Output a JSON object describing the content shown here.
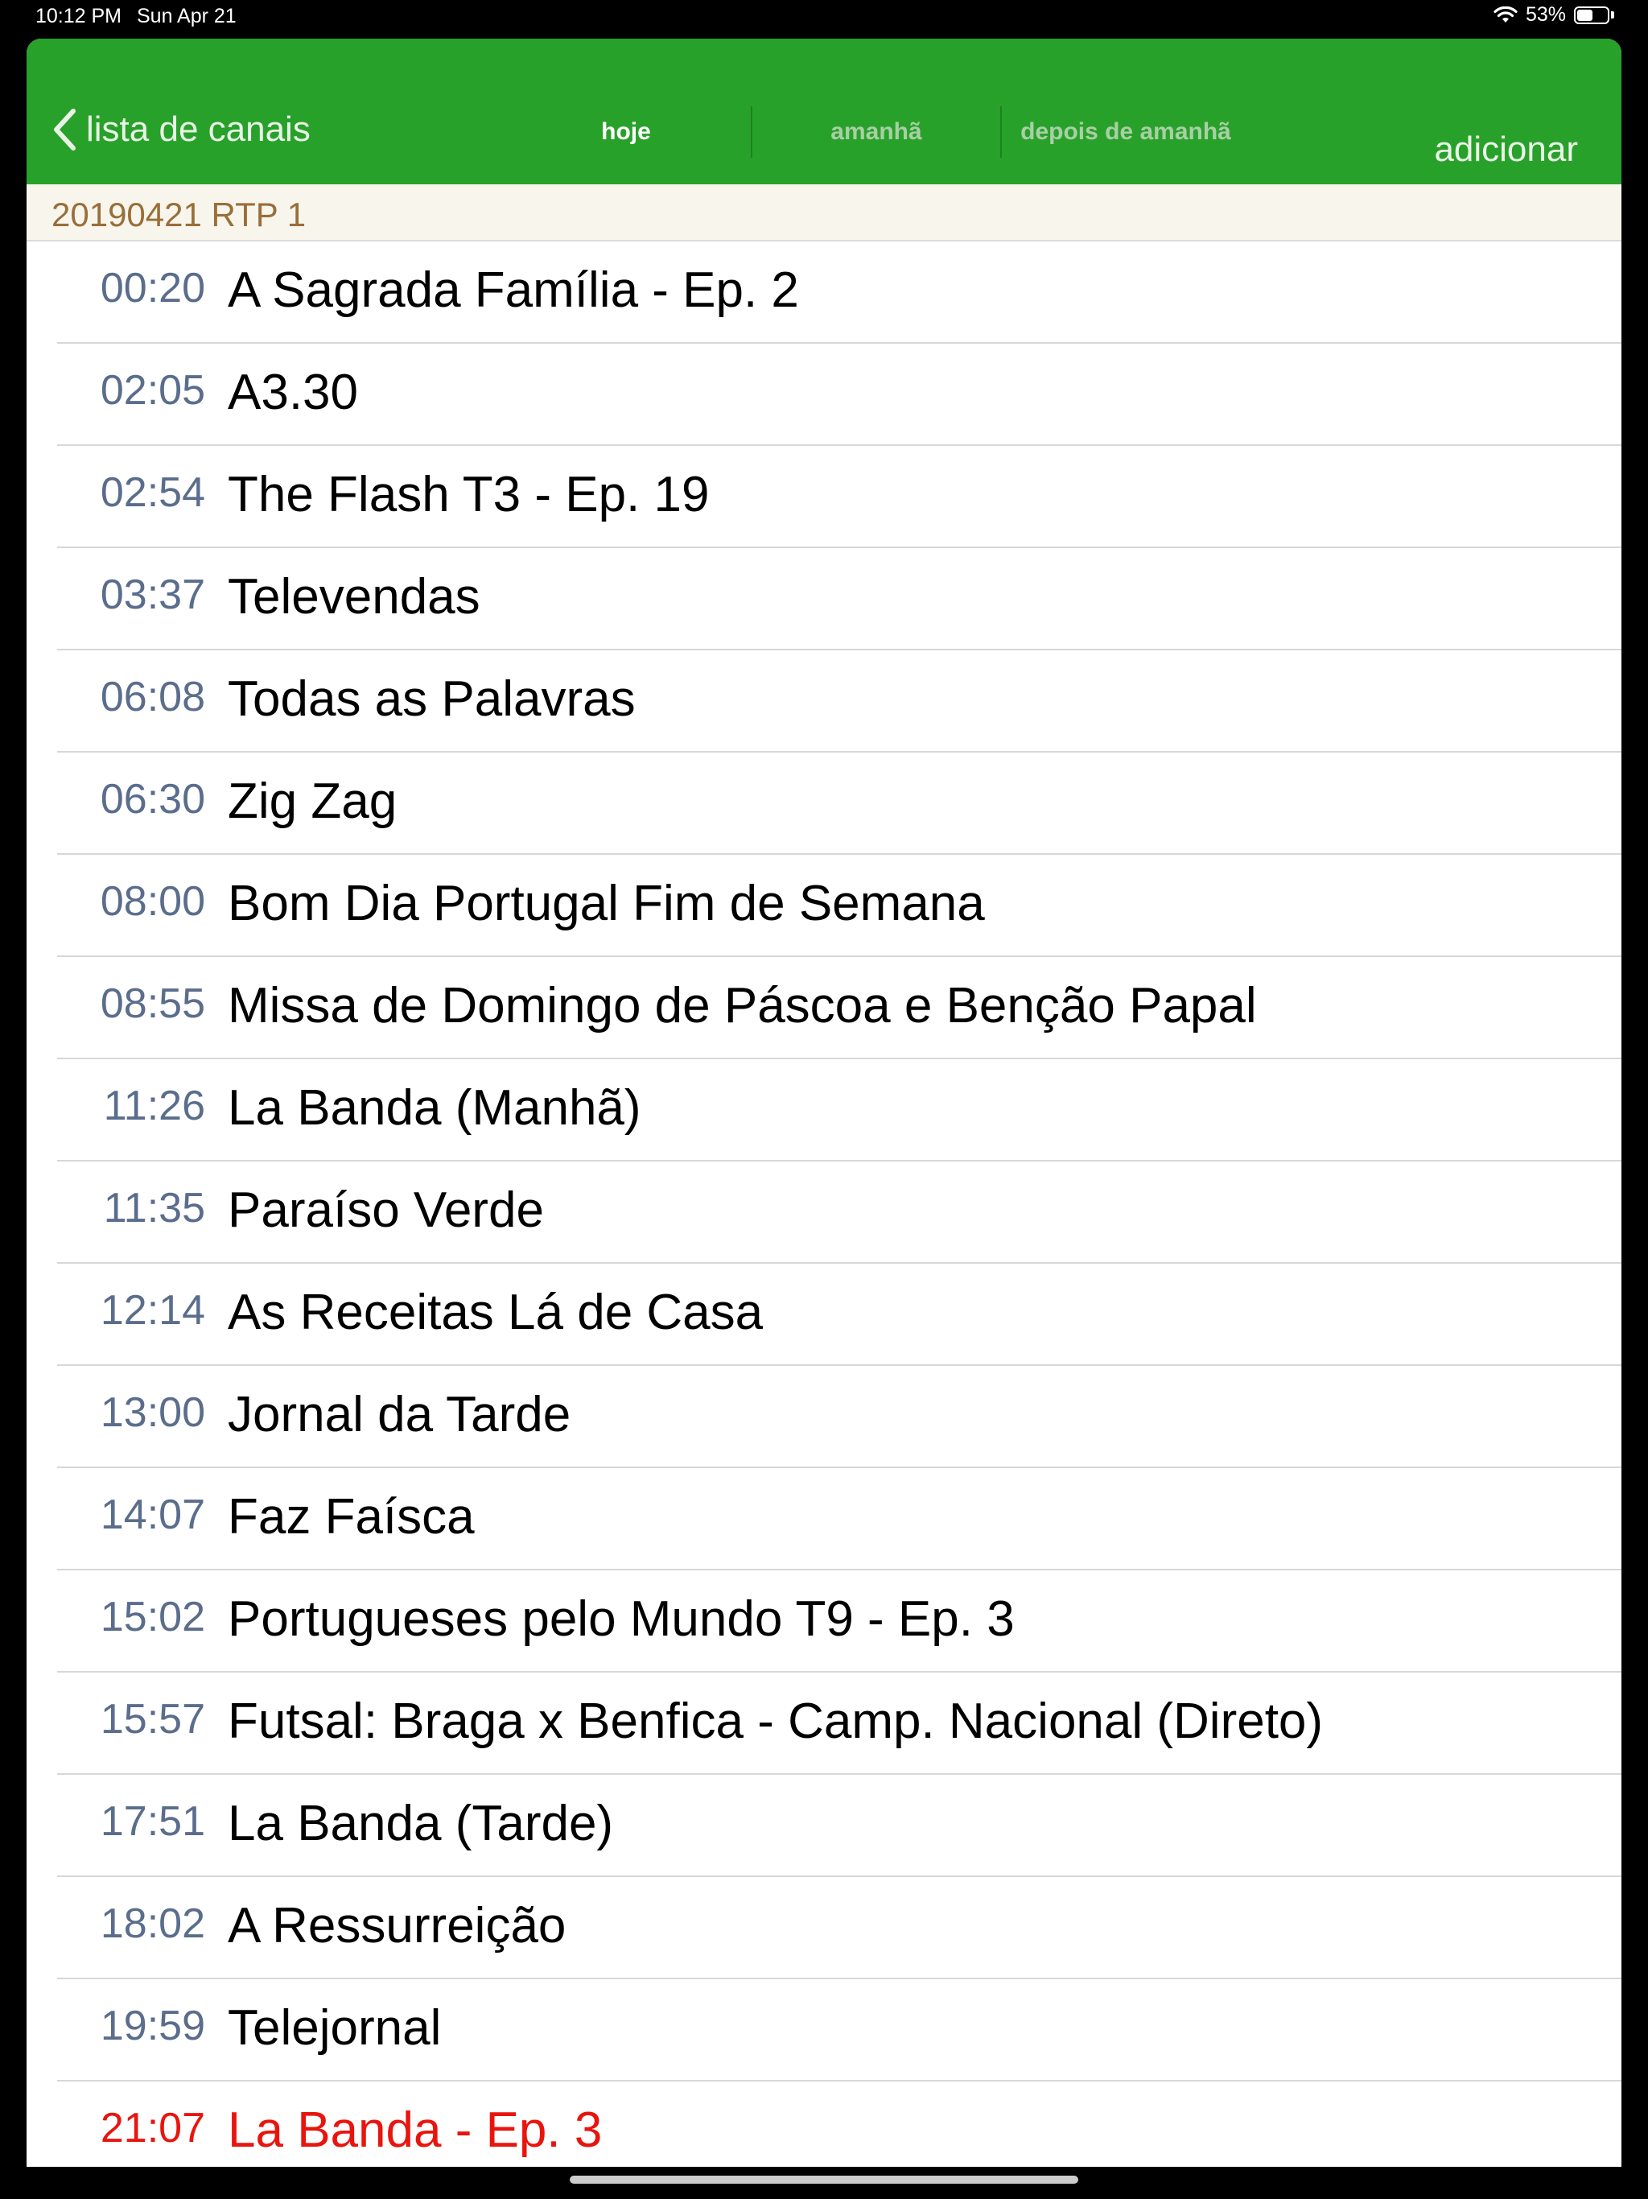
{
  "status_bar": {
    "time": "10:12 PM",
    "date": "Sun Apr 21",
    "battery_percent": "53%",
    "battery_level": 0.53
  },
  "nav": {
    "back_label": "lista de canais",
    "tabs": [
      {
        "label": "hoje",
        "active": true
      },
      {
        "label": "amanhã",
        "active": false
      },
      {
        "label": "depois de amanhã",
        "active": false
      }
    ],
    "add_label": "adicionar",
    "bar_color": "#28a12a"
  },
  "section": {
    "title": "20190421 RTP 1"
  },
  "programs": [
    {
      "time": "00:20",
      "title": "A Sagrada Família - Ep. 2"
    },
    {
      "time": "02:05",
      "title": "A3.30"
    },
    {
      "time": "02:54",
      "title": "The Flash T3 - Ep. 19"
    },
    {
      "time": "03:37",
      "title": "Televendas"
    },
    {
      "time": "06:08",
      "title": "Todas as Palavras"
    },
    {
      "time": "06:30",
      "title": "Zig Zag"
    },
    {
      "time": "08:00",
      "title": "Bom Dia Portugal Fim de Semana"
    },
    {
      "time": "08:55",
      "title": "Missa de Domingo de Páscoa e Benção Papal"
    },
    {
      "time": "11:26",
      "title": "La Banda (Manhã)"
    },
    {
      "time": "11:35",
      "title": "Paraíso Verde"
    },
    {
      "time": "12:14",
      "title": "As Receitas Lá de Casa"
    },
    {
      "time": "13:00",
      "title": "Jornal da Tarde"
    },
    {
      "time": "14:07",
      "title": "Faz Faísca"
    },
    {
      "time": "15:02",
      "title": "Portugueses pelo Mundo T9 - Ep. 3"
    },
    {
      "time": "15:57",
      "title": "Futsal: Braga x Benfica - Camp. Nacional (Direto)"
    },
    {
      "time": "17:51",
      "title": "La Banda (Tarde)"
    },
    {
      "time": "18:02",
      "title": "A Ressurreição"
    },
    {
      "time": "19:59",
      "title": "Telejornal"
    },
    {
      "time": "21:07",
      "title": "La Banda - Ep. 3",
      "now": true
    }
  ],
  "colors": {
    "time_text": "#5a6d8c",
    "now_text": "#e8150f",
    "section_text": "#9a6e3a"
  }
}
